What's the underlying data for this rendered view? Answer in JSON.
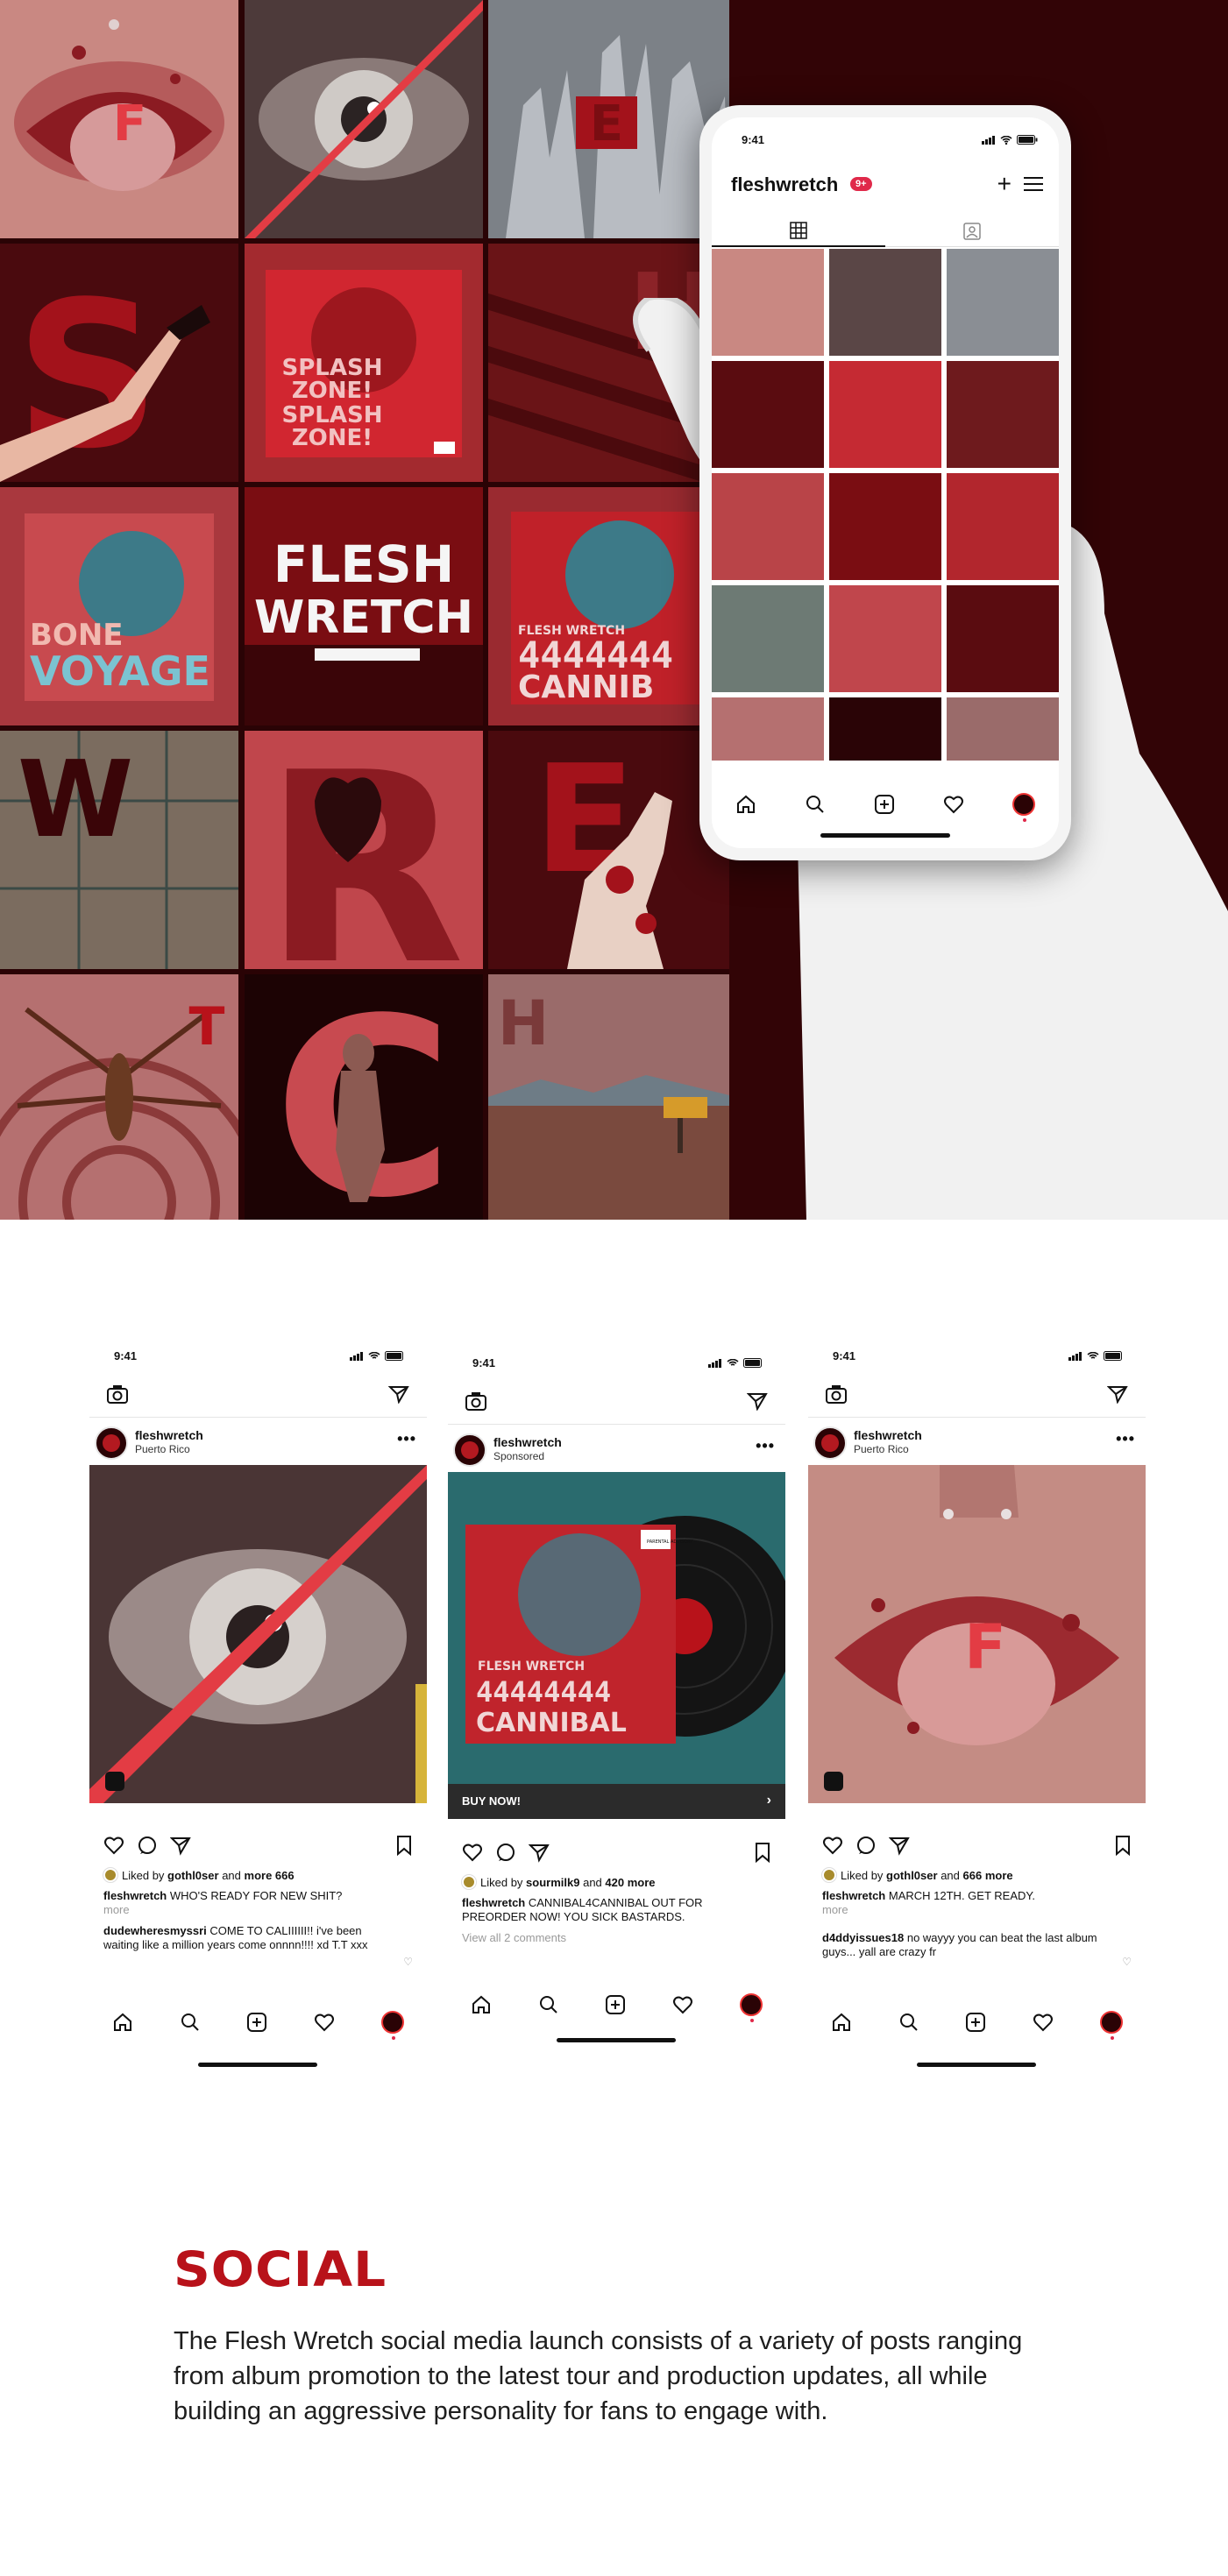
{
  "hero": {
    "grid_tiles": [
      {
        "name": "tile-mouth-f",
        "letter": "F"
      },
      {
        "name": "tile-eye",
        "letter": ""
      },
      {
        "name": "tile-hands-e",
        "letter": "E"
      },
      {
        "name": "tile-s-hand",
        "letter": "S"
      },
      {
        "name": "tile-splash-zone",
        "letter": ""
      },
      {
        "name": "tile-h-stripes",
        "letter": "H"
      },
      {
        "name": "tile-bone-voyage",
        "letter": ""
      },
      {
        "name": "tile-flesh-wretch-logo",
        "letter": ""
      },
      {
        "name": "tile-cannibal",
        "letter": ""
      },
      {
        "name": "tile-w-metal",
        "letter": "W"
      },
      {
        "name": "tile-r-heart",
        "letter": "R"
      },
      {
        "name": "tile-e-hand-blood",
        "letter": "E"
      },
      {
        "name": "tile-t-spider",
        "letter": "T"
      },
      {
        "name": "tile-c-figure",
        "letter": "C"
      },
      {
        "name": "tile-h-desert",
        "letter": "H"
      }
    ],
    "art": {
      "splash_zone": "SPLASH ZONE! SPLASH ZONE!",
      "bone_voyage_1": "BONE",
      "bone_voyage_2": "VOYAGE",
      "band_small": "FLESH WRETCH",
      "logo_line1": "FLESH",
      "logo_line2": "WRETCH",
      "cannibal_num": "4444444",
      "cannibal_word": "CANNIB"
    },
    "phone": {
      "time": "9:41",
      "username": "fleshwretch",
      "badge": "9+",
      "tabs": [
        "grid-icon",
        "tagged-icon"
      ],
      "nav_icons": [
        "home-icon",
        "search-icon",
        "add-post-icon",
        "heart-icon",
        "profile-avatar"
      ]
    }
  },
  "posts": [
    {
      "time": "9:41",
      "username": "fleshwretch",
      "subtitle": "Puerto Rico",
      "liked_by_user": "gothl0ser",
      "liked_tail": "more 666",
      "caption_user": "fleshwretch",
      "caption": "WHO'S READY FOR NEW SHIT?",
      "more": "more",
      "comment_user": "dudewheresmyssri",
      "comment": "COME TO CALIIIIII!! i've been waiting like a million years come onnnn!!!! xd T.T xxx"
    },
    {
      "time": "9:41",
      "username": "fleshwretch",
      "subtitle": "Sponsored",
      "cta": "BUY NOW!",
      "liked_by_user": "sourmilk9",
      "liked_tail": "420 more",
      "caption_user": "fleshwretch",
      "caption": "CANNIBAL4CANNIBAL OUT FOR PREORDER NOW! YOU SICK BASTARDS.",
      "view_comments": "View all 2 comments",
      "album_num": "44444444",
      "album_word": "CANNIBAL",
      "album_band": "FLESH WRETCH",
      "advisory": "PARENTAL ADVISORY"
    },
    {
      "time": "9:41",
      "username": "fleshwretch",
      "subtitle": "Puerto Rico",
      "liked_by_user": "gothl0ser",
      "liked_tail": "666 more",
      "caption_user": "fleshwretch",
      "caption": "MARCH 12TH. GET READY.",
      "more": "more",
      "comment_user": "d4ddyissues18",
      "comment": "no wayyy you can beat the last album guys... yall are crazy fr",
      "letter": "F"
    }
  ],
  "common": {
    "liked_prefix": "Liked by",
    "and": "and"
  },
  "social": {
    "title": "SOCIAL",
    "body": "The Flesh Wretch social media launch consists of a variety of posts ranging from album promotion to the latest tour and production updates, all while building an aggressive personality for fans to engage with."
  },
  "colors": {
    "brand_red": "#b8121a",
    "dark_maroon": "#2a0305",
    "badge_pink": "#e0294a"
  }
}
